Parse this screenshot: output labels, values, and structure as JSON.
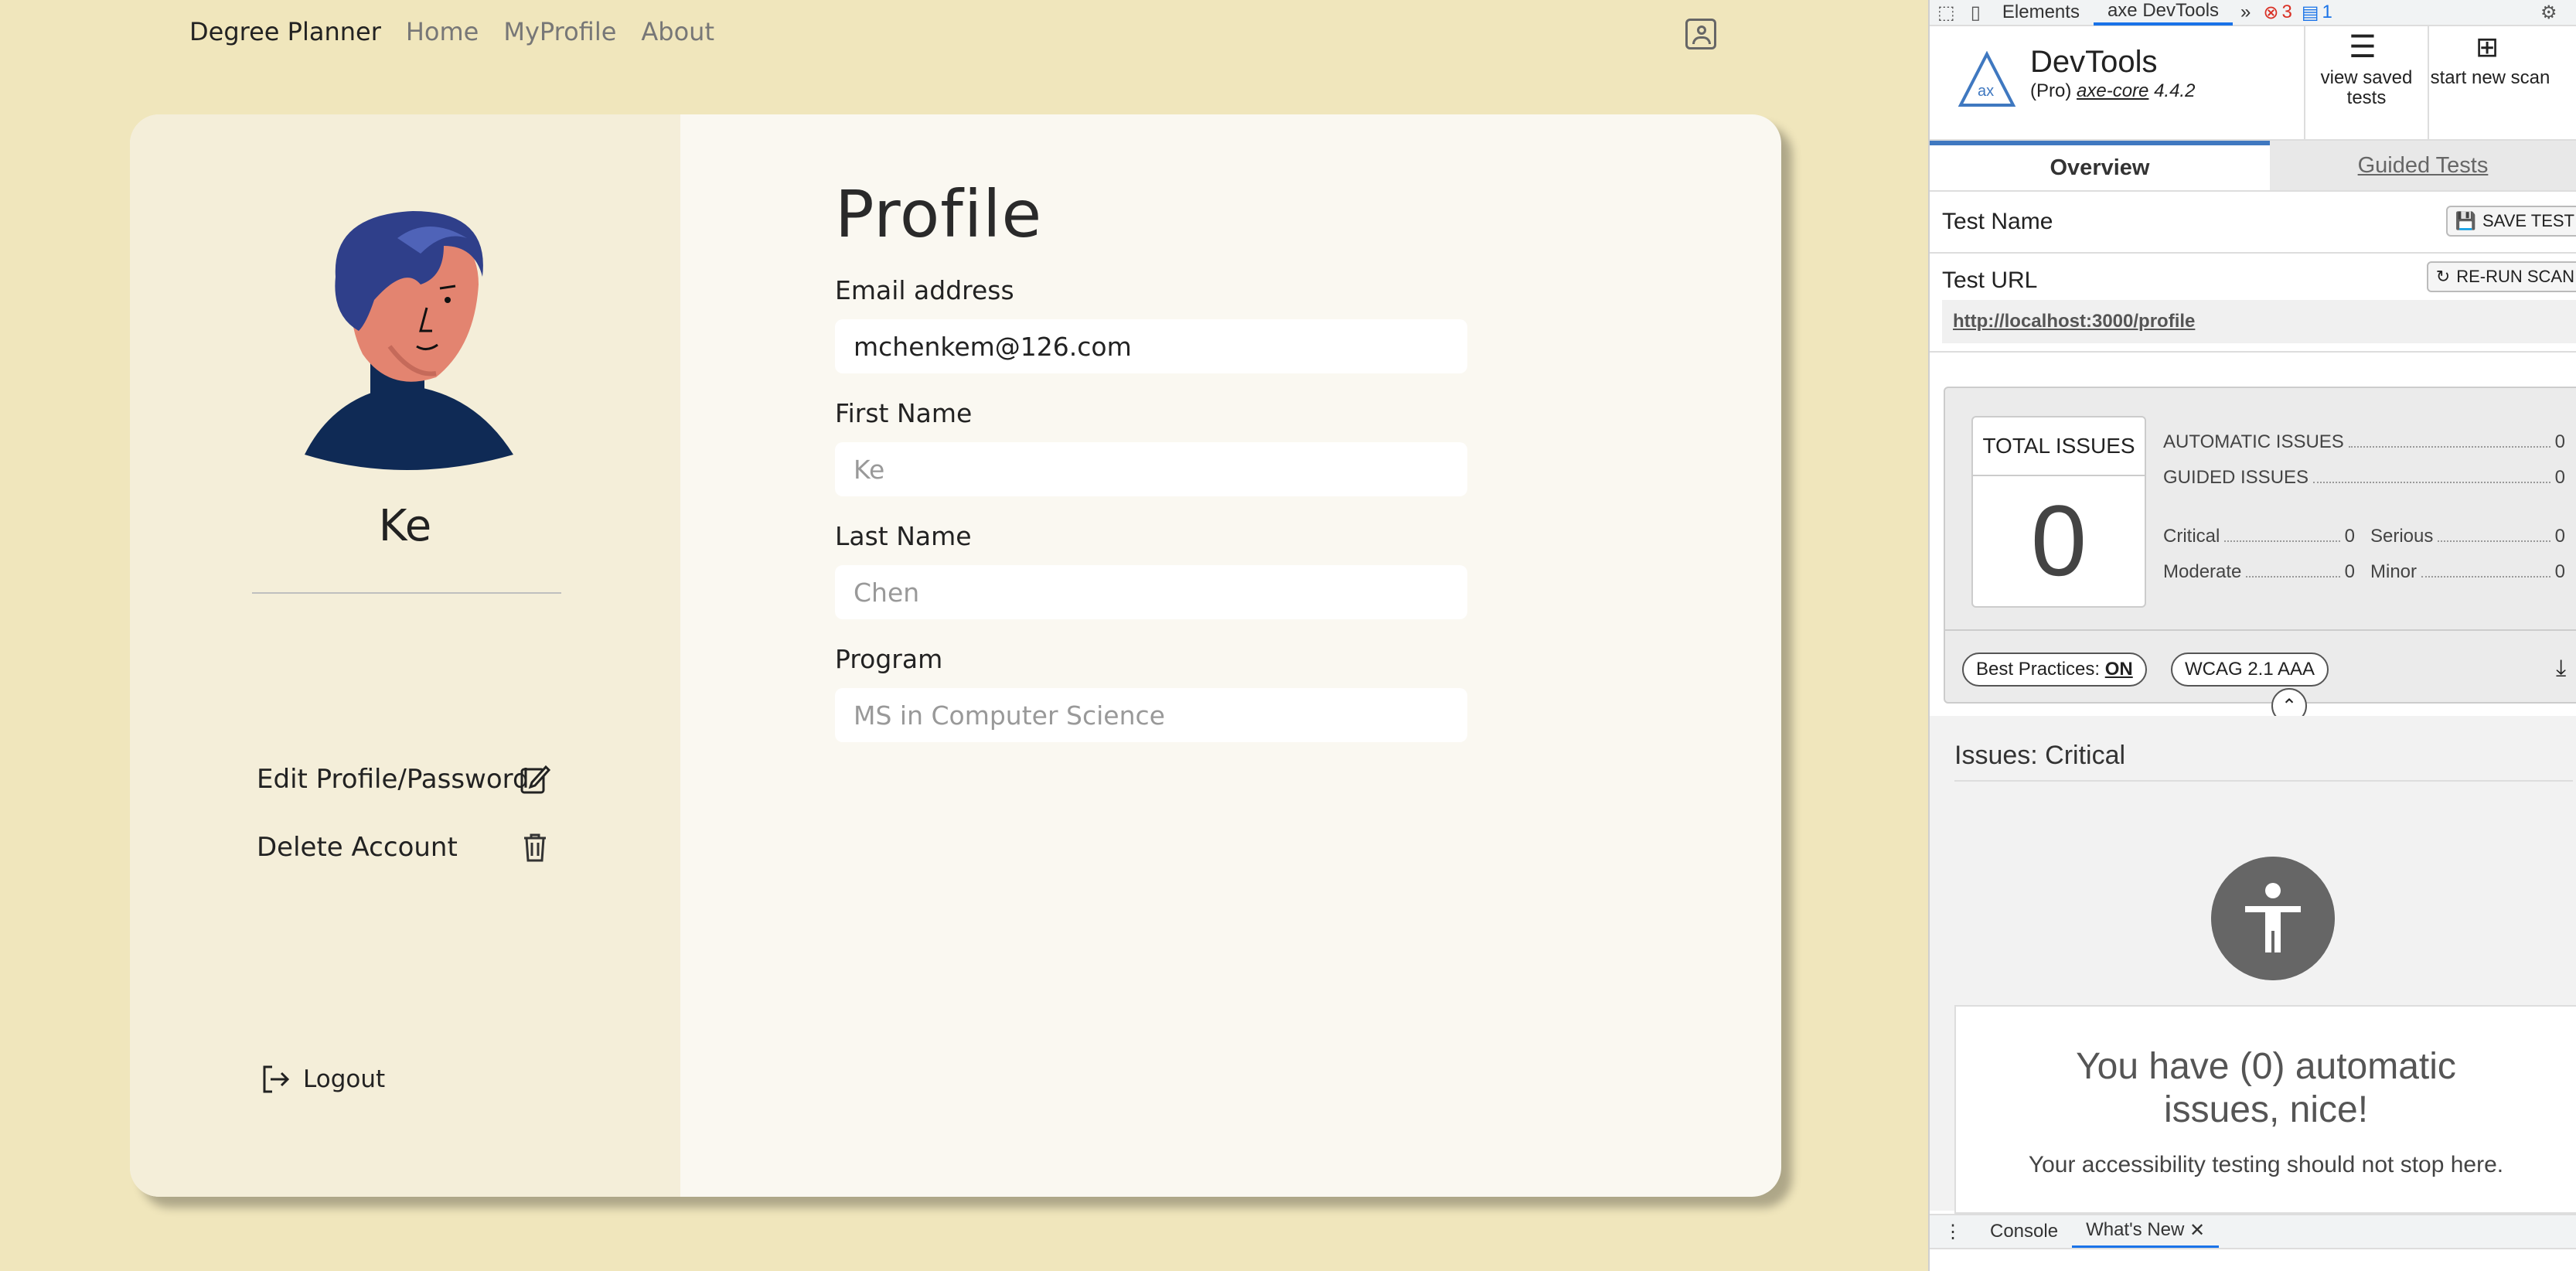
{
  "nav": {
    "brand": "Degree Planner",
    "links": [
      "Home",
      "MyProfile",
      "About"
    ],
    "profile_icon": "user-square-icon"
  },
  "profile": {
    "username": "Ke",
    "title": "Profile",
    "actions": {
      "edit": "Edit Profile/Password",
      "delete": "Delete Account",
      "logout": "Logout"
    },
    "fields": {
      "email_label": "Email address",
      "email_value": "mchenkem@126.com",
      "first_label": "First Name",
      "first_placeholder": "Ke",
      "last_label": "Last Name",
      "last_placeholder": "Chen",
      "program_label": "Program",
      "program_placeholder": "MS in Computer Science"
    }
  },
  "devtools": {
    "topbar": {
      "tabs": [
        "Elements",
        "axe DevTools"
      ],
      "error_count": "3",
      "message_count": "1"
    },
    "header": {
      "title": "DevTools",
      "edition": "(Pro)",
      "engine": "axe-core",
      "version": "4.4.2",
      "view_saved": "view saved tests",
      "start_new": "start new scan"
    },
    "tabs": {
      "overview": "Overview",
      "guided": "Guided Tests"
    },
    "test_name_label": "Test Name",
    "save_test": "SAVE TEST",
    "test_url_label": "Test URL",
    "rerun": "RE-RUN SCAN",
    "url": "http://localhost:3000/profile",
    "summary": {
      "total_label": "TOTAL ISSUES",
      "total": "0",
      "automatic_label": "AUTOMATIC ISSUES",
      "automatic": "0",
      "guided_label": "GUIDED ISSUES",
      "guided": "0",
      "critical_label": "Critical",
      "critical": "0",
      "serious_label": "Serious",
      "serious": "0",
      "moderate_label": "Moderate",
      "moderate": "0",
      "minor_label": "Minor",
      "minor": "0",
      "best_practices_label": "Best Practices:",
      "best_practices_value": "ON",
      "wcag": "WCAG 2.1 AAA"
    },
    "issues_heading": "Issues: Critical",
    "empty": {
      "title": "You have (0) automatic issues, nice!",
      "subtitle": "Your accessibility testing should not stop here."
    },
    "drawer": {
      "console": "Console",
      "whats_new": "What's New"
    }
  }
}
